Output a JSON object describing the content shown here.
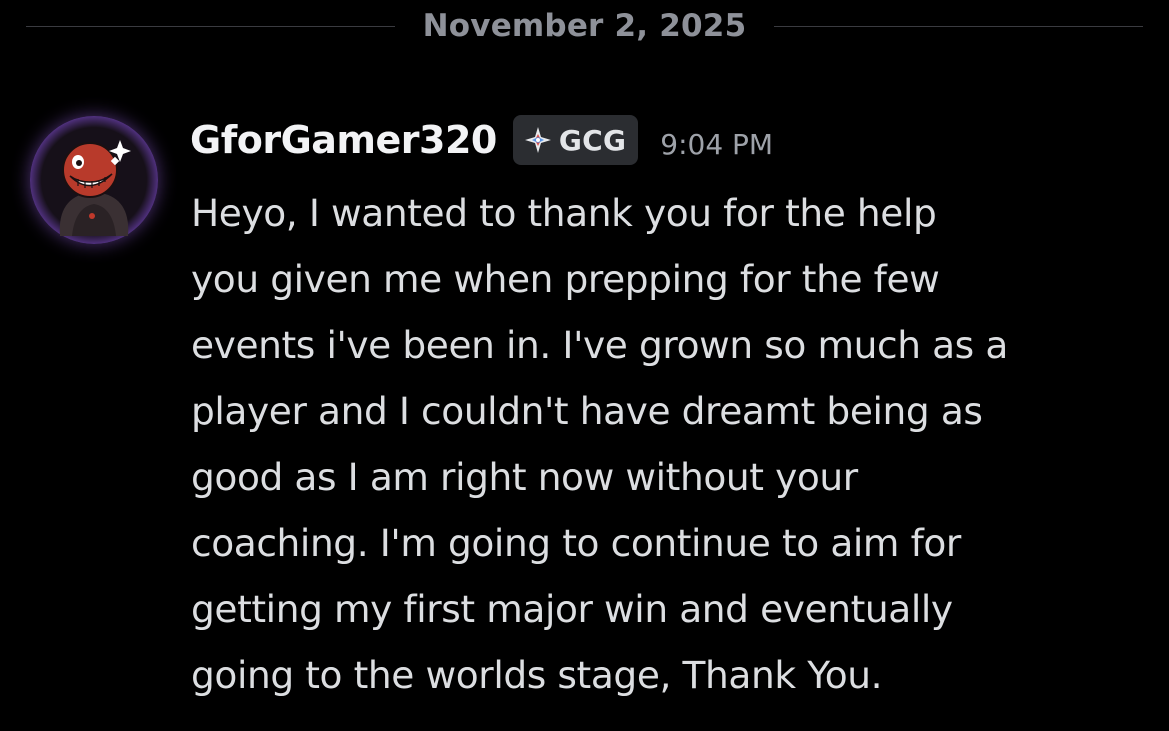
{
  "date_divider": {
    "label": "November 2, 2025"
  },
  "message": {
    "author": "GforGamer320",
    "server_tag": {
      "icon": "diamond-compass-icon",
      "label": "GCG"
    },
    "timestamp": "9:04 PM",
    "avatar": {
      "icon": "red-grinning-character-avatar",
      "ring_color": "#a971ff"
    },
    "lines": [
      "Heyo, I wanted to thank you for the help",
      "you given me when prepping for the few",
      "events i've been in. I've grown so much as a",
      "player and I couldn't have dreamt being as",
      "good as I am right now without your",
      "coaching. I'm going to continue to aim for",
      "getting my first major win and eventually",
      "going to the worlds stage, Thank You."
    ]
  },
  "colors": {
    "background": "#000000",
    "username": "#f2f3f5",
    "text": "#dcdee1",
    "muted": "#9ea2a9",
    "tag_bg": "#2b2d31"
  }
}
